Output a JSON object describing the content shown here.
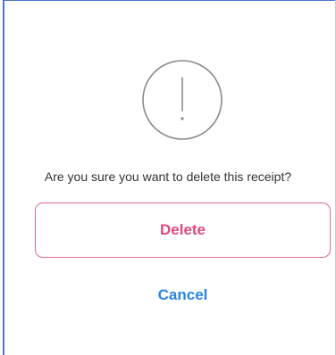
{
  "dialog": {
    "icon": "exclamation-circle-icon",
    "message": "Are you sure you want to delete this receipt?",
    "delete_label": "Delete",
    "cancel_label": "Cancel"
  },
  "colors": {
    "icon_stroke": "#8a8a8a",
    "delete_border": "#e26a8e",
    "delete_text": "#e0497a",
    "cancel_text": "#2b84e0",
    "message_text": "#333333"
  }
}
